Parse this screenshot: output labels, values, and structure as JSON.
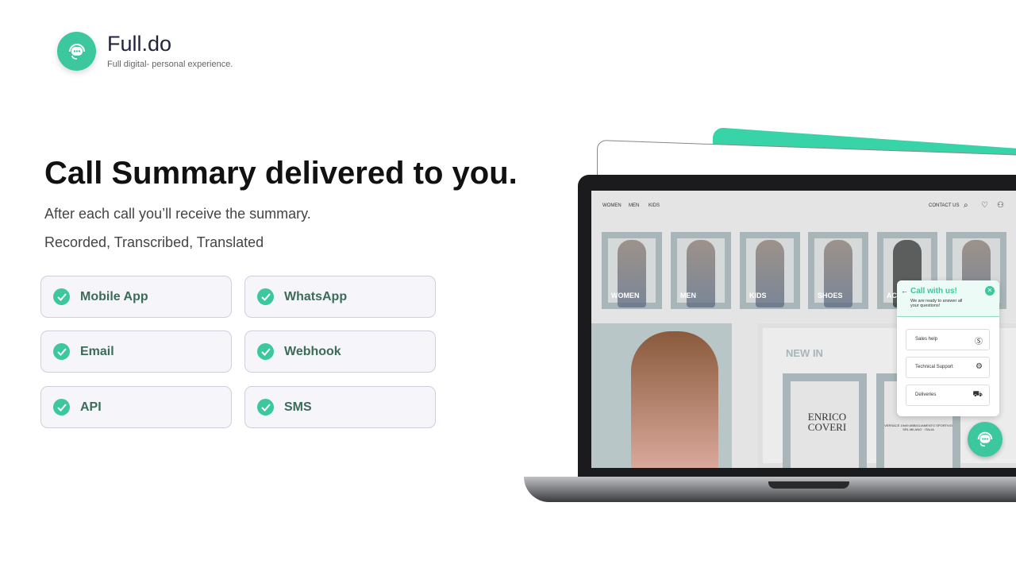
{
  "brand": {
    "name": "Full.do",
    "tagline": "Full digital- personal experience."
  },
  "hero": {
    "title": "Call Summary delivered to you.",
    "line1": "After each call you’ll receive the summary.",
    "line2": "Recorded, Transcribed, Translated"
  },
  "channels": [
    "Mobile App",
    "WhatsApp",
    "Email",
    "Webhook",
    "API",
    "SMS"
  ],
  "site": {
    "nav": [
      "WOMEN",
      "MEN",
      "KIDS"
    ],
    "contact": "CONTACT US",
    "categories": [
      "WOMEN",
      "MEN",
      "KIDS",
      "SHOES",
      "ACCESSORIES",
      ""
    ],
    "new_in": "NEW IN",
    "brand1": "ENRICO COVERI",
    "brand2": "19V69",
    "brand2_sub": "VERSACE 19•69 ABBIGLIAMENTO SPORTIVO SRL MILANO · ITALIA"
  },
  "widget": {
    "title": "Call with us!",
    "subtitle": "We are ready to answer all your questions!",
    "options": [
      {
        "label": "Sales help",
        "icon": "dollar-icon"
      },
      {
        "label": "Technical Support",
        "icon": "support-icon"
      },
      {
        "label": "Deliveries",
        "icon": "truck-icon"
      }
    ]
  },
  "colors": {
    "accent": "#3cc79f",
    "text_green": "#3c6b57"
  }
}
